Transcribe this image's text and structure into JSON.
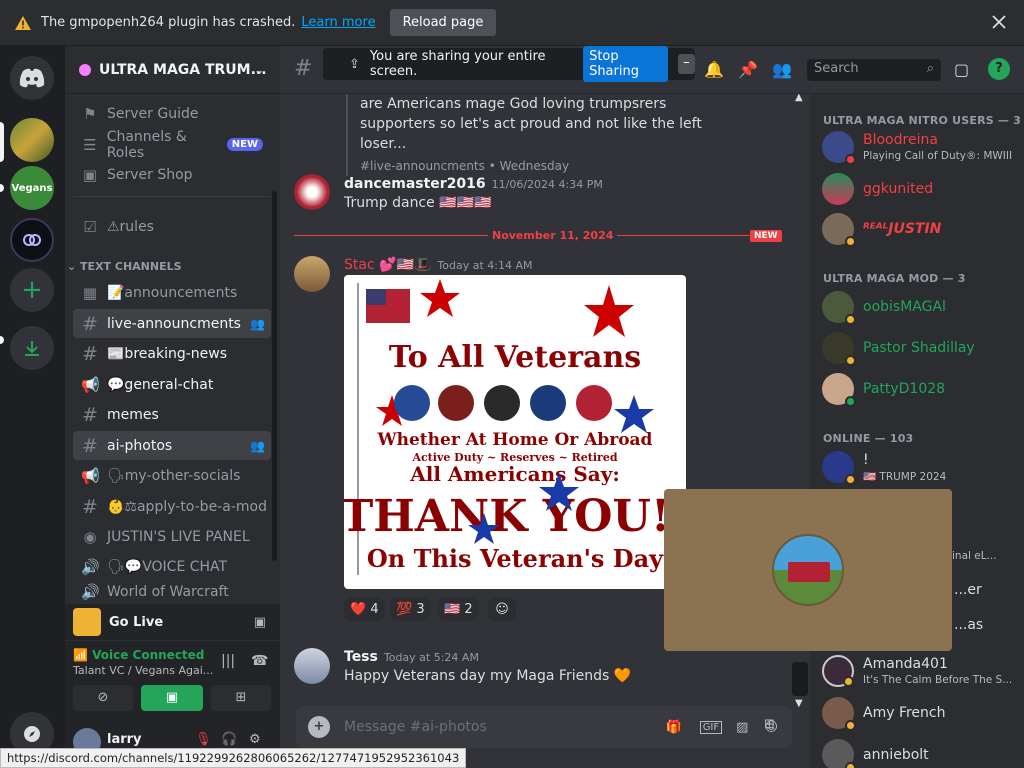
{
  "banner": {
    "message": "The gmpopenh264 plugin has crashed.",
    "link": "Learn more",
    "reload": "Reload page"
  },
  "server": {
    "name": "ULTRA MAGA TRUM..."
  },
  "sidebar": {
    "top_items": [
      {
        "label": "Server Guide",
        "icon": "signpost-icon"
      },
      {
        "label": "Channels & Roles",
        "icon": "channels-roles-icon",
        "badge": "NEW"
      },
      {
        "label": "Server Shop",
        "icon": "shop-icon"
      }
    ],
    "rules": "⚠rules",
    "category": "TEXT CHANNELS",
    "channels": [
      {
        "label": "📝announcements"
      },
      {
        "label": "live-announcments"
      },
      {
        "label": "📰breaking-news"
      },
      {
        "label": "💬general-chat"
      },
      {
        "label": "memes"
      },
      {
        "label": "ai-photos"
      },
      {
        "label": "🗣my-other-socials"
      },
      {
        "label": "👶⚖apply-to-be-a-mod"
      },
      {
        "label": "JUSTIN'S LIVE PANEL"
      },
      {
        "label": "🗣💬VOICE CHAT"
      },
      {
        "label": "World of Warcraft"
      }
    ]
  },
  "golive": {
    "label": "Go Live"
  },
  "voice": {
    "status": "Voice Connected",
    "channel": "Talant VC / Vegans Agai..."
  },
  "user": {
    "name": "larry"
  },
  "topbar": {
    "share_text": "You are sharing your entire screen.",
    "stop_sharing": "Stop Sharing",
    "search_placeholder": "Search"
  },
  "messages": {
    "prev_text": "are Americans mage God loving trumpsrers supporters so let's act proud and not like the left loser...",
    "prev_meta": "#live-announcments • Wednesday",
    "dance": {
      "author": "dancemaster2016",
      "time": "11/06/2024 4:34 PM",
      "text": "Trump dance 🇺🇸🇺🇸🇺🇸"
    },
    "divider": "November 11, 2024",
    "divider_badge": "NEW",
    "stac": {
      "author": "Stac 💕🇺🇸🎩",
      "time": "Today at 4:14 AM"
    },
    "image": {
      "line1": "To All Veterans",
      "line2": "Whether At Home Or Abroad",
      "line3": "Active Duty ~ Reserves ~ Retired",
      "line4": "All Americans Say:",
      "line5": "THANK YOU!!",
      "line6": "On This Veteran's Day"
    },
    "reactions": [
      {
        "emoji": "❤️",
        "count": "4"
      },
      {
        "emoji": "💯",
        "count": "3"
      },
      {
        "emoji": "🇺🇸",
        "count": "2"
      }
    ],
    "tess": {
      "author": "Tess",
      "time": "Today at 5:24 AM",
      "text": "Happy Veterans day my Maga Friends 🧡"
    }
  },
  "composer": {
    "placeholder": "Message #ai-photos"
  },
  "members": {
    "group1": "ULTRA MAGA NITRO USERS — 3",
    "group1_members": [
      {
        "name": "Bloodreina",
        "status": "Playing Call of Duty®: MWIII",
        "color": "#f23f43"
      },
      {
        "name": "ggkunited",
        "status": "",
        "color": "#f23f43"
      },
      {
        "name": "ᴿᴱᴬᴸJUSTIN",
        "status": "",
        "color": "#f23f43"
      }
    ],
    "group2": "ULTRA MAGA MOD — 3",
    "group2_members": [
      {
        "name": "oobisMAGAl",
        "color": "#23a55a"
      },
      {
        "name": "Pastor Shadillay",
        "color": "#23a55a"
      },
      {
        "name": "PattyD1028",
        "color": "#23a55a"
      }
    ],
    "group3": "ONLINE — 103",
    "online": [
      {
        "name": "!",
        "status": "🇺🇸 TRUMP 2024"
      },
      {
        "name": "",
        "status": "...inal eL..."
      },
      {
        "name": "...er",
        "status": ""
      },
      {
        "name": "...as",
        "status": ""
      },
      {
        "name": "Amanda401",
        "status": "It's The Calm Before The S..."
      },
      {
        "name": "Amy French",
        "status": ""
      },
      {
        "name": "anniebolt",
        "status": ""
      }
    ]
  },
  "statusbar": {
    "url": "https://discord.com/channels/1192299262806065262/1277471952952361043"
  }
}
